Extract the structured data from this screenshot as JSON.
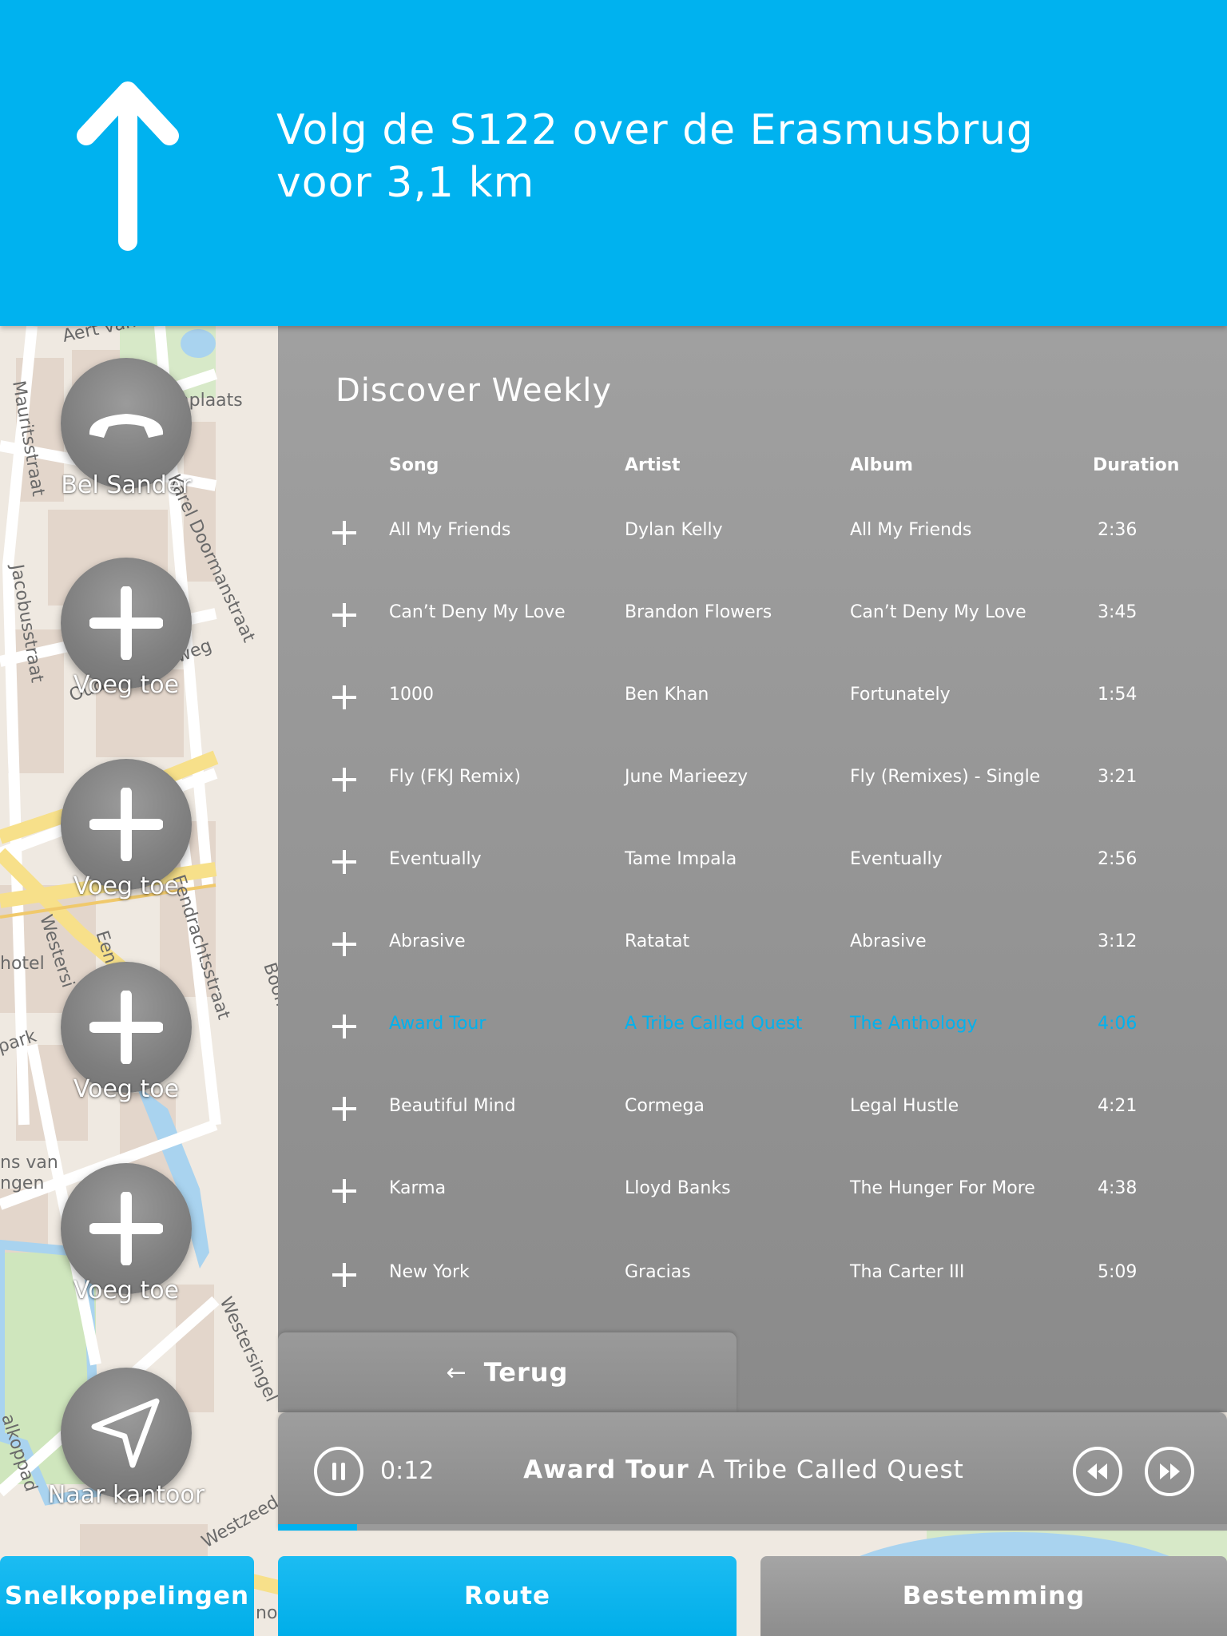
{
  "navigation": {
    "instruction_line1": "Volg de S122 over de Erasmusbrug",
    "instruction_line2": "voor 3,1 km",
    "direction_icon": "arrow-up-icon"
  },
  "map_labels": {
    "aert": "Aert van",
    "kerkhof": "rtsenplaats",
    "mauritsstraat": "Mauritsstraat",
    "jacobusstraat": "Jacobusstraat",
    "karel_doorman": "Karel Doormanstraat",
    "oude_binnenweg": "Oude Binnenweg",
    "eendracht": "Eendrachtsstraat",
    "westersingel": "Westersingel",
    "westersi": "Westersi",
    "eend": "Eend",
    "hotel": "hotel",
    "park": "park",
    "museum_1": "ns van",
    "museum_2": "ngen",
    "boom": "Boom",
    "westzeed": "Westzeed",
    "kop": "alkoppad",
    "now": "nov"
  },
  "shortcuts": [
    {
      "label": "Bel Sander",
      "icon": "phone-icon"
    },
    {
      "label": "Voeg toe",
      "icon": "plus-icon"
    },
    {
      "label": "Voeg toe",
      "icon": "plus-icon"
    },
    {
      "label": "Voeg toe",
      "icon": "plus-icon"
    },
    {
      "label": "Voeg toe",
      "icon": "plus-icon"
    },
    {
      "label": "Naar kantoor",
      "icon": "navigation-arrow-icon"
    }
  ],
  "playlist": {
    "title": "Discover Weekly",
    "columns": {
      "song": "Song",
      "artist": "Artist",
      "album": "Album",
      "duration": "Duration"
    },
    "active_color": "#00b2ef",
    "tracks": [
      {
        "song": "All My Friends",
        "artist": "Dylan Kelly",
        "album": "All My Friends",
        "duration": "2:36"
      },
      {
        "song": "Can’t Deny My Love",
        "artist": "Brandon Flowers",
        "album": "Can’t Deny My Love",
        "duration": "3:45"
      },
      {
        "song": "1000",
        "artist": "Ben Khan",
        "album": "Fortunately",
        "duration": "1:54"
      },
      {
        "song": "Fly (FKJ Remix)",
        "artist": "June Marieezy",
        "album": "Fly (Remixes) - Single",
        "duration": "3:21"
      },
      {
        "song": "Eventually",
        "artist": "Tame Impala",
        "album": "Eventually",
        "duration": "2:56"
      },
      {
        "song": "Abrasive",
        "artist": "Ratatat",
        "album": "Abrasive",
        "duration": "3:12"
      },
      {
        "song": "Award Tour",
        "artist": "A Tribe Called Quest",
        "album": "The Anthology",
        "duration": "4:06",
        "active": true
      },
      {
        "song": "Beautiful Mind",
        "artist": "Cormega",
        "album": "Legal Hustle",
        "duration": "4:21"
      },
      {
        "song": "Karma",
        "artist": "Lloyd Banks",
        "album": "The Hunger For More",
        "duration": "4:38"
      },
      {
        "song": "New York",
        "artist": "Gracias",
        "album": "Tha Carter III",
        "duration": "5:09"
      }
    ]
  },
  "back": {
    "label": "Terug",
    "icon": "arrow-left-icon"
  },
  "player": {
    "elapsed": "0:12",
    "track_title": "Award Tour",
    "track_artist": "A Tribe Called Quest",
    "progress_fraction": 0.083
  },
  "tabs": {
    "shortcuts": "Snelkoppelingen",
    "route": "Route",
    "destination": "Bestemming"
  }
}
